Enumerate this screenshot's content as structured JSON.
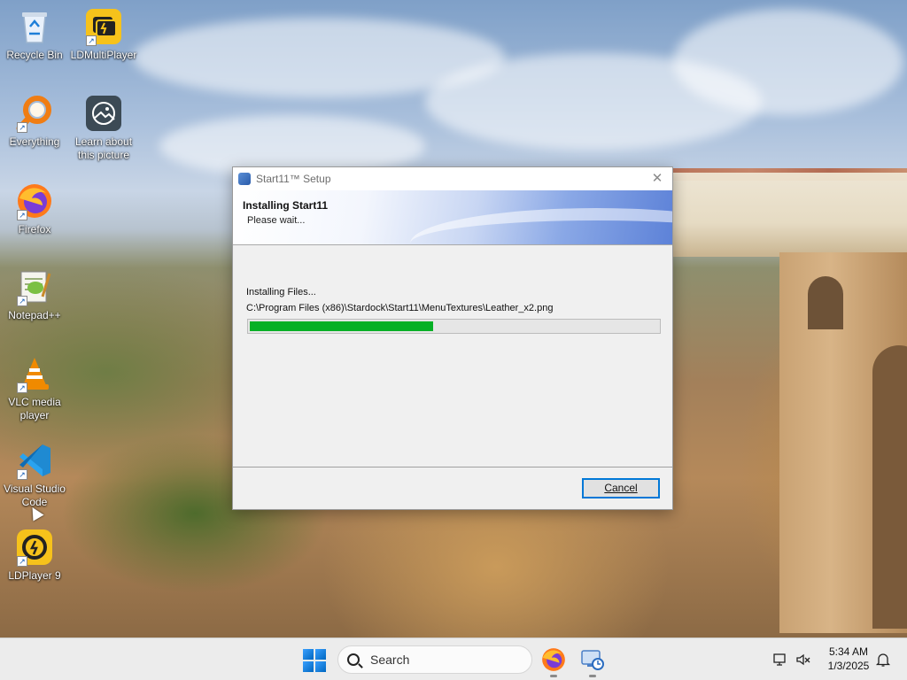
{
  "desktop": {
    "icons": [
      {
        "label": "Recycle Bin",
        "icon": "recycle-bin-icon"
      },
      {
        "label": "LDMultiPlayer",
        "icon": "ldmultiplayer-icon"
      },
      {
        "label": "Everything",
        "icon": "everything-search-icon"
      },
      {
        "label": "Learn about this picture",
        "icon": "camera-icon"
      },
      {
        "label": "Firefox",
        "icon": "firefox-icon"
      },
      {
        "label": "Notepad++",
        "icon": "notepad-plus-plus-icon"
      },
      {
        "label": "VLC media player",
        "icon": "vlc-cone-icon"
      },
      {
        "label": "Visual Studio Code",
        "icon": "vscode-icon"
      },
      {
        "label": "LDPlayer 9",
        "icon": "ldplayer-icon"
      }
    ]
  },
  "dialog": {
    "title": "Start11™ Setup",
    "close_icon": "close-icon",
    "header_title": "Installing Start11",
    "header_subtitle": "Please wait...",
    "status_text": "Installing Files...",
    "current_file": "C:\\Program Files (x86)\\Stardock\\Start11\\MenuTextures\\Leather_x2.png",
    "progress_fraction": 0.45,
    "progress_color": "#06b025",
    "cancel_label": "Cancel"
  },
  "taskbar": {
    "search_placeholder": "Search",
    "apps": [
      "firefox-icon",
      "setup-installer-icon"
    ],
    "clock_time": "5:34 AM",
    "clock_date": "1/3/2025",
    "tray_icons": [
      "network-icon",
      "volume-muted-icon",
      "notification-bell-icon"
    ]
  }
}
